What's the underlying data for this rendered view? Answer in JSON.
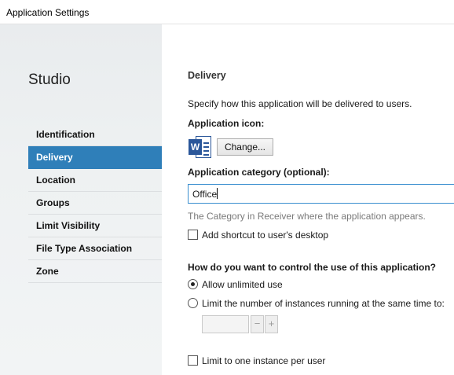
{
  "window": {
    "title": "Application Settings"
  },
  "sidebar": {
    "brand": "Studio",
    "items": [
      {
        "label": "Identification",
        "active": false
      },
      {
        "label": "Delivery",
        "active": true
      },
      {
        "label": "Location",
        "active": false
      },
      {
        "label": "Groups",
        "active": false
      },
      {
        "label": "Limit Visibility",
        "active": false
      },
      {
        "label": "File Type Association",
        "active": false
      },
      {
        "label": "Zone",
        "active": false
      }
    ]
  },
  "main": {
    "heading": "Delivery",
    "intro": "Specify how this application will be delivered to users.",
    "icon_label": "Application icon:",
    "icon": {
      "name": "word-icon",
      "letter": "W",
      "color": "#2b579a"
    },
    "change_button": "Change...",
    "category_label": "Application category (optional):",
    "category_value": "Office",
    "category_hint": "The Category in Receiver where the application appears.",
    "shortcut_label": "Add shortcut to user's desktop",
    "shortcut_checked": false,
    "control_question": "How do you want to control the use of this application?",
    "radio_unlimited": "Allow unlimited use",
    "radio_unlimited_selected": true,
    "radio_limit": "Limit the number of instances running at the same time to:",
    "radio_limit_selected": false,
    "instance_value": "",
    "stepper_minus": "−",
    "stepper_plus": "+",
    "one_instance_label": "Limit to one instance per user",
    "one_instance_checked": false
  },
  "colors": {
    "accent": "#2f7fb9",
    "focus": "#3a8ecf",
    "hint": "#7a7a7a"
  }
}
